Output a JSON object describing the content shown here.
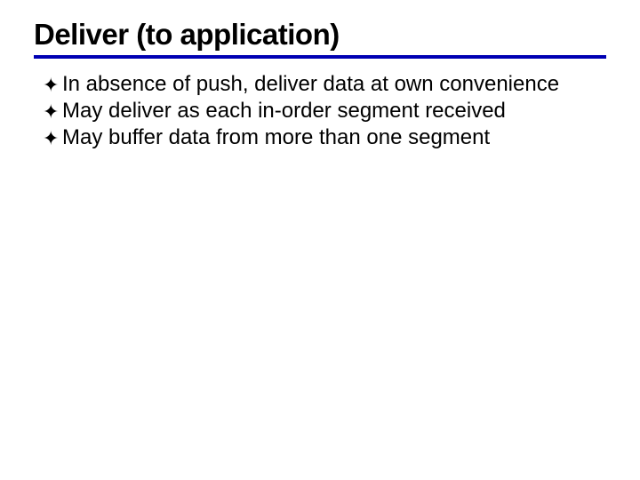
{
  "slide": {
    "title": "Deliver (to application)",
    "bullets": [
      "In absence of push, deliver data at own convenience",
      "May deliver as each in-order segment received",
      "May buffer data from more than one segment"
    ]
  },
  "theme": {
    "rule_color": "#0000b3"
  }
}
